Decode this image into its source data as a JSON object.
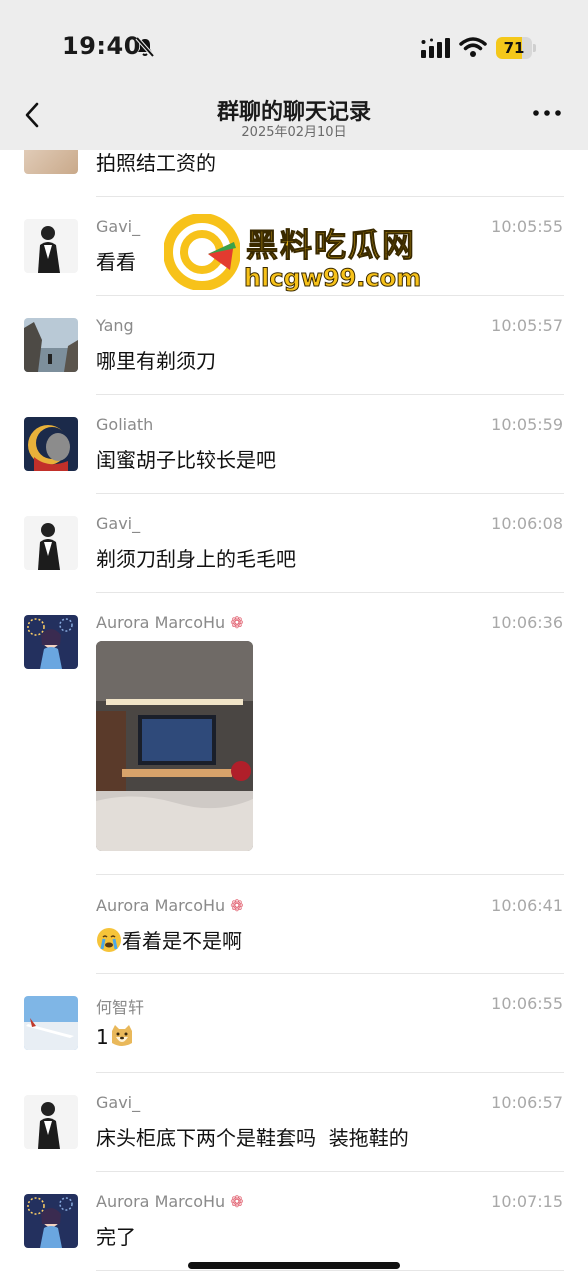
{
  "status": {
    "time": "19:40",
    "battery": "71",
    "battery_level": 0.71
  },
  "nav": {
    "title": "群聊的聊天记录",
    "date": "2025年02月10日"
  },
  "watermark": {
    "title": "黑料吃瓜网",
    "url": "hlcgw99.com"
  },
  "messages": [
    {
      "sender": "",
      "time": "",
      "text": "拍照结工资的"
    },
    {
      "sender": "Gavi_",
      "time": "10:05:55",
      "text": "看看"
    },
    {
      "sender": "Yang",
      "time": "10:05:57",
      "text": "哪里有剃须刀"
    },
    {
      "sender": "Goliath",
      "time": "10:05:59",
      "text": "闺蜜胡子比较长是吧"
    },
    {
      "sender": "Gavi_",
      "time": "10:06:08",
      "text": "剃须刀刮身上的毛毛吧"
    },
    {
      "sender": "Aurora MarcoHu",
      "time": "10:06:36",
      "text": ""
    },
    {
      "sender": "Aurora MarcoHu",
      "time": "10:06:41",
      "text": "看着是不是啊"
    },
    {
      "sender": "何智轩",
      "time": "10:06:55",
      "text": "1"
    },
    {
      "sender": "Gavi_",
      "time": "10:06:57",
      "text": "床头柜底下两个是鞋套吗  装拖鞋的"
    },
    {
      "sender": "Aurora MarcoHu",
      "time": "10:07:15",
      "text": "完了"
    }
  ],
  "colors": {
    "topbar": "#ededed",
    "battery": "#f4c81a",
    "watermark": "#f7c21a"
  }
}
